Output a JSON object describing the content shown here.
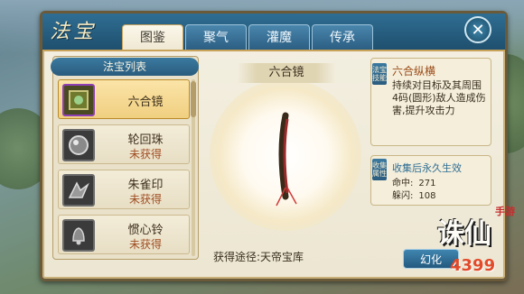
{
  "header": {
    "title": "法宝",
    "tabs": [
      {
        "label": "图鉴",
        "active": true
      },
      {
        "label": "聚气",
        "active": false
      },
      {
        "label": "灌魔",
        "active": false
      },
      {
        "label": "传承",
        "active": false
      }
    ]
  },
  "list": {
    "title": "法宝列表",
    "items": [
      {
        "name": "六合镜",
        "status": "",
        "selected": true
      },
      {
        "name": "轮回珠",
        "status": "未获得"
      },
      {
        "name": "朱雀印",
        "status": "未获得"
      },
      {
        "name": "惯心铃",
        "status": "未获得"
      }
    ]
  },
  "detail": {
    "item_title": "六合镜",
    "source": "获得途径:天帝宝库"
  },
  "skill": {
    "tag": "法宝技能",
    "name": "六合纵横",
    "description": "持续对目标及其周围4码(圆形)敌人造成伤害,提升攻击力"
  },
  "bonus": {
    "tag": "收集属性",
    "title": "收集后永久生效",
    "stats": [
      {
        "label": "命中:",
        "value": "271"
      },
      {
        "label": "躲闪:",
        "value": "108"
      }
    ]
  },
  "action": {
    "label": "幻化"
  },
  "logo": {
    "main": "诛仙",
    "sub": "手游",
    "num": "4399"
  }
}
